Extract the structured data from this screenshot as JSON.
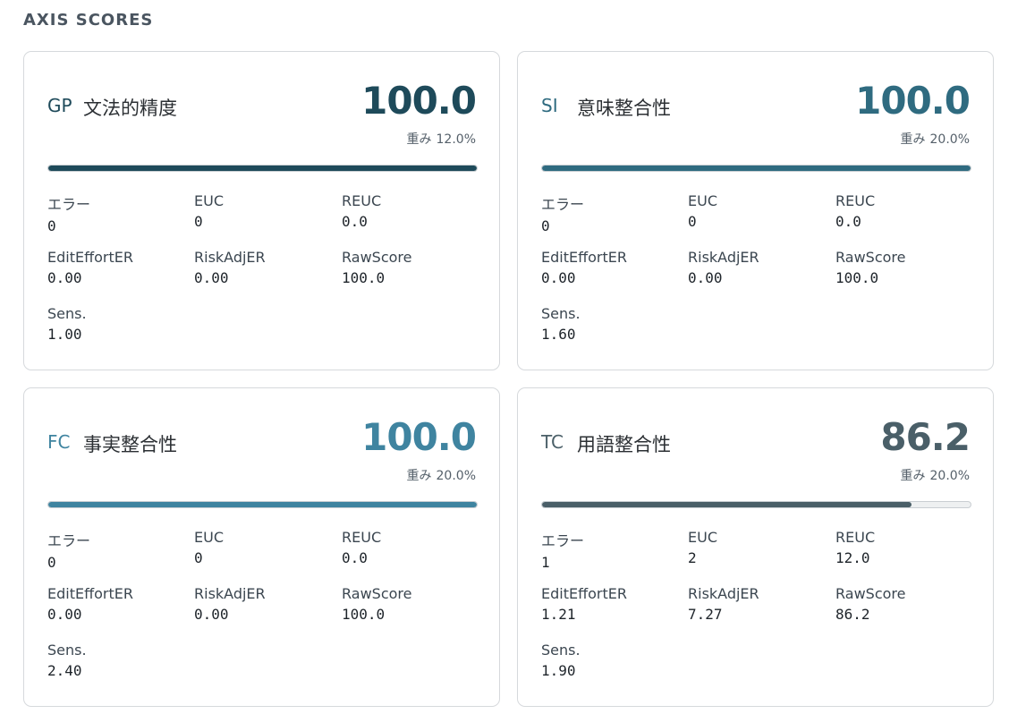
{
  "section_title": "AXIS SCORES",
  "weight_label": "重み",
  "metric_labels": {
    "errors": "エラー",
    "euc": "EUC",
    "reuc": "REUC",
    "edit_effort": "EditEffortER",
    "risk_adj": "RiskAdjER",
    "raw_score": "RawScore",
    "sens": "Sens."
  },
  "cards": [
    {
      "code": "GP",
      "name": "文法的精度",
      "score": "100.0",
      "weight": "12.0%",
      "score_fraction": 1.0,
      "accent": "#1e4a5a",
      "errors": "0",
      "euc": "0",
      "reuc": "0.0",
      "edit_effort": "0.00",
      "risk_adj": "0.00",
      "raw_score": "100.0",
      "sens": "1.00"
    },
    {
      "code": "SI",
      "name": "意味整合性",
      "score": "100.0",
      "weight": "20.0%",
      "score_fraction": 1.0,
      "accent": "#2f6b80",
      "errors": "0",
      "euc": "0",
      "reuc": "0.0",
      "edit_effort": "0.00",
      "risk_adj": "0.00",
      "raw_score": "100.0",
      "sens": "1.60"
    },
    {
      "code": "FC",
      "name": "事実整合性",
      "score": "100.0",
      "weight": "20.0%",
      "score_fraction": 1.0,
      "accent": "#3f84a0",
      "errors": "0",
      "euc": "0",
      "reuc": "0.0",
      "edit_effort": "0.00",
      "risk_adj": "0.00",
      "raw_score": "100.0",
      "sens": "2.40"
    },
    {
      "code": "TC",
      "name": "用語整合性",
      "score": "86.2",
      "weight": "20.0%",
      "score_fraction": 0.862,
      "accent": "#4a5f68",
      "errors": "1",
      "euc": "2",
      "reuc": "12.0",
      "edit_effort": "1.21",
      "risk_adj": "7.27",
      "raw_score": "86.2",
      "sens": "1.90"
    }
  ]
}
